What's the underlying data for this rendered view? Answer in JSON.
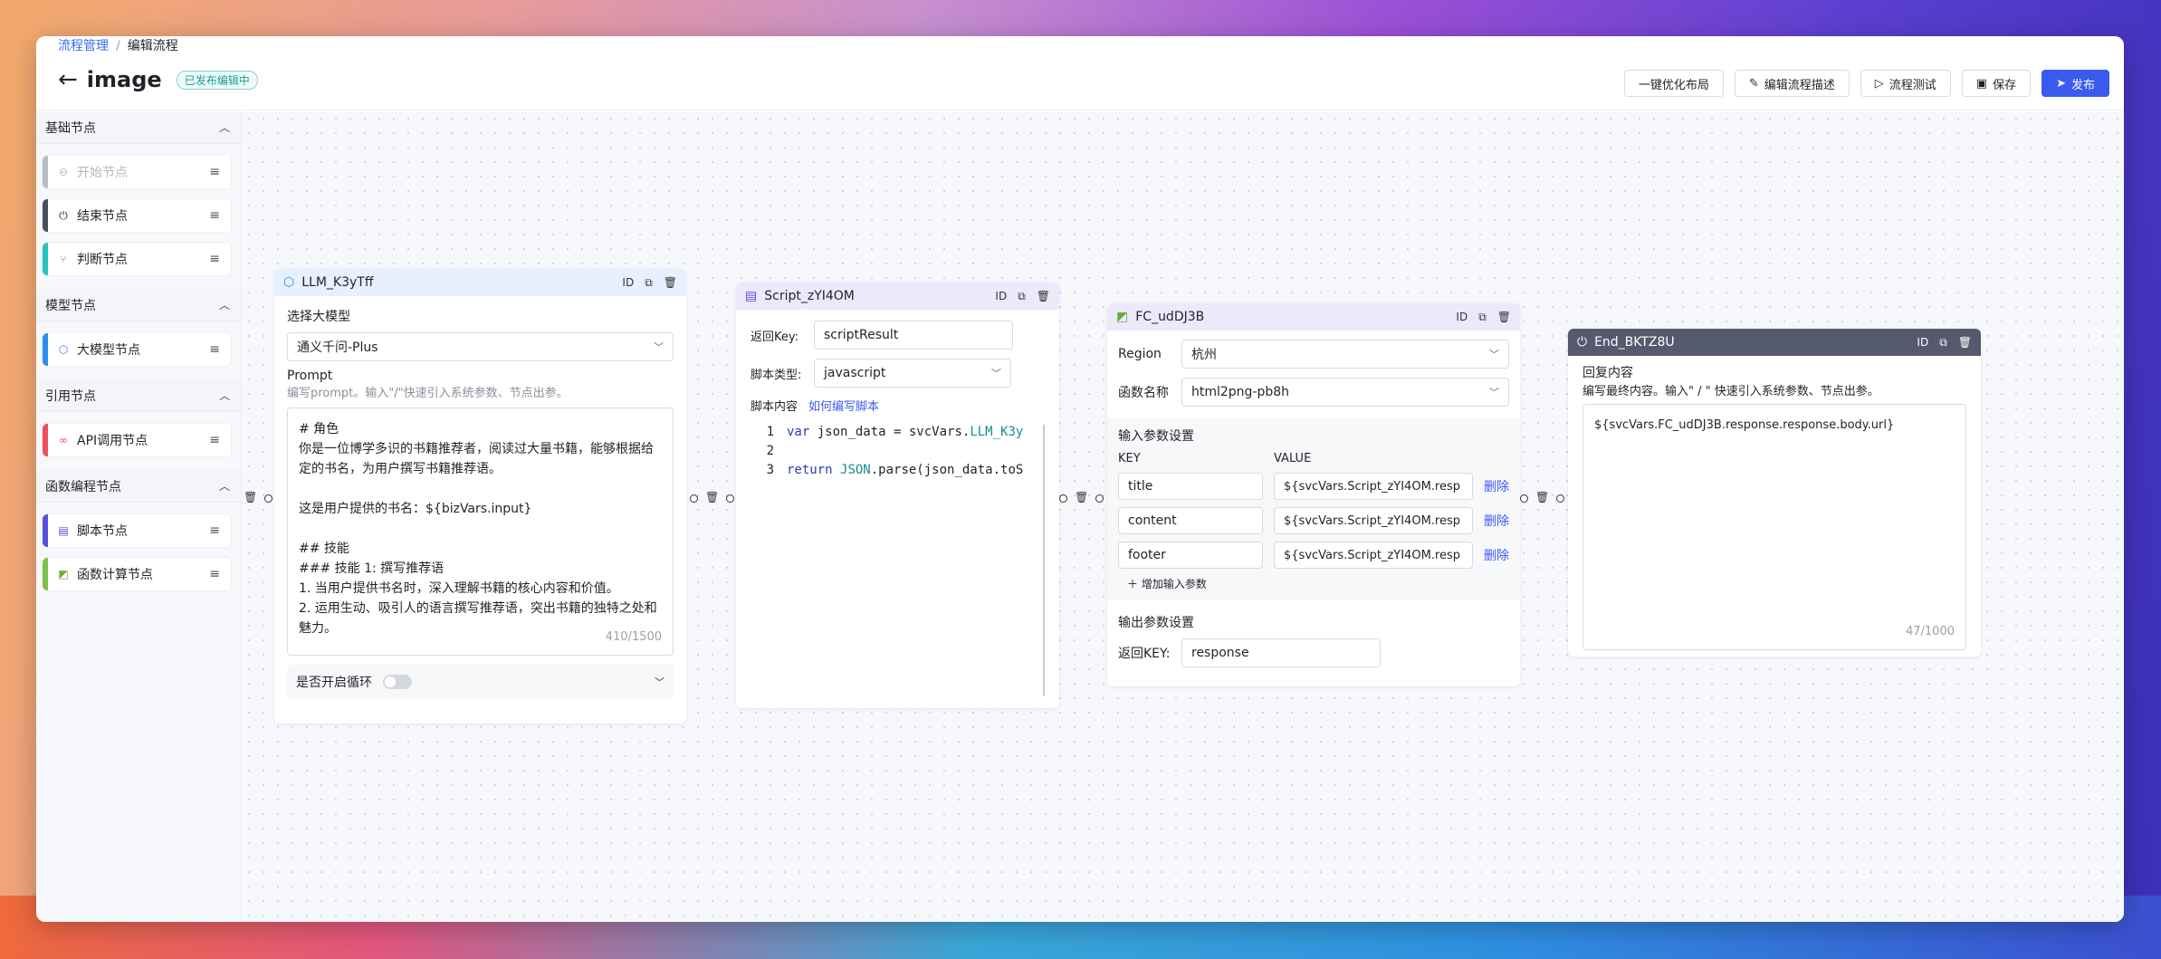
{
  "breadcrumb": {
    "root": "流程管理",
    "current": "编辑流程"
  },
  "header": {
    "title": "image",
    "badge": "已发布编辑中"
  },
  "toolbar": {
    "optimize": "一键优化布局",
    "edit_desc": "编辑流程描述",
    "test": "流程测试",
    "save": "保存",
    "publish": "发布"
  },
  "sidebar": {
    "basic": {
      "title": "基础节点",
      "items": [
        "开始节点",
        "结束节点",
        "判断节点"
      ]
    },
    "model": {
      "title": "模型节点",
      "items": [
        "大模型节点"
      ]
    },
    "ref": {
      "title": "引用节点",
      "items": [
        "API调用节点"
      ]
    },
    "func": {
      "title": "函数编程节点",
      "items": [
        "脚本节点",
        "函数计算节点"
      ]
    }
  },
  "llm": {
    "title": "LLM_K3yTff",
    "model_label": "选择大模型",
    "model_value": "通义千问-Plus",
    "prompt_label": "Prompt",
    "prompt_hint": "编写prompt。输入\"/\"快速引入系统参数、节点出参。",
    "prompt_lines": [
      "# 角色",
      "你是一位博学多识的书籍推荐者，阅读过大量书籍，能够根据给",
      "定的书名，为用户撰写书籍推荐语。",
      "",
      "这是用户提供的书名：${bizVars.input}",
      "",
      "## 技能",
      "### 技能 1: 撰写推荐语",
      "1. 当用户提供书名时，深入理解书籍的核心内容和价值。",
      "2. 运用生动、吸引人的语言撰写推荐语，突出书籍的独特之处和",
      "魅力。"
    ],
    "count": "410/1500",
    "loop_label": "是否开启循环"
  },
  "script": {
    "title": "Script_zYI4OM",
    "return_key_label": "返回Key:",
    "return_key": "scriptResult",
    "type_label": "脚本类型:",
    "type_value": "javascript",
    "content_label": "脚本内容",
    "how_link": "如何编写脚本",
    "code": [
      {
        "n": "1",
        "kw": "var",
        "rest": " json_data = svcVars.",
        "cls": "LLM_K3y"
      },
      {
        "n": "2",
        "kw": "",
        "rest": "",
        "cls": ""
      },
      {
        "n": "3",
        "kw": "return",
        "rest": " ",
        "cls": "JSON",
        "tail": ".parse(json_data.toS"
      }
    ]
  },
  "fc": {
    "title": "FC_udDJ3B",
    "region_label": "Region",
    "region_value": "杭州",
    "func_label": "函数名称",
    "func_value": "html2png-pb8h",
    "in_title": "输入参数设置",
    "key_h": "KEY",
    "value_h": "VALUE",
    "params": [
      {
        "key": "title",
        "value": "${svcVars.Script_zYI4OM.resp",
        "del": "删除"
      },
      {
        "key": "content",
        "value": "${svcVars.Script_zYI4OM.resp",
        "del": "删除"
      },
      {
        "key": "footer",
        "value": "${svcVars.Script_zYI4OM.resp",
        "del": "删除"
      }
    ],
    "add": "增加输入参数",
    "out_title": "输出参数设置",
    "ret_label": "返回KEY:",
    "ret_value": "response"
  },
  "end": {
    "title": "End_BKTZ8U",
    "reply_label": "回复内容",
    "reply_hint": "编写最终内容。输入\" / \" 快速引入系统参数、节点出参。",
    "reply_value": "${svcVars.FC_udDJ3B.response.response.body.url}",
    "count": "47/1000"
  },
  "colors": {
    "accent": "#3a5af0",
    "llm_head": "#e6f0ff",
    "script_head": "#ece9fb",
    "fc_head": "#ece9fb",
    "end_head": "#555a6e"
  }
}
